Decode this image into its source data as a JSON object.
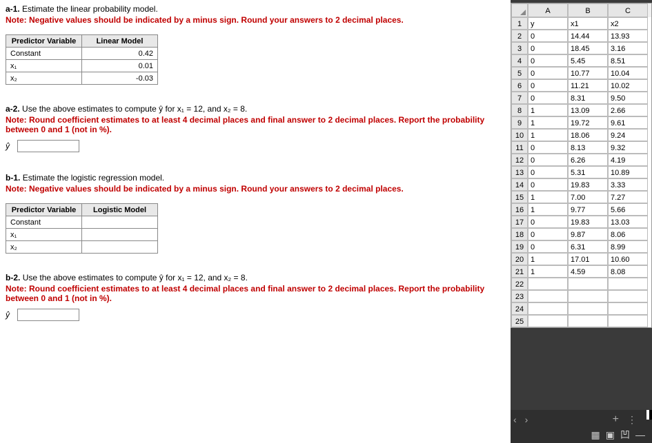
{
  "a1": {
    "title_prefix": "a-1.",
    "title_text": "Estimate the linear probability model.",
    "note": "Note: Negative values should be indicated by a minus sign. Round your answers to 2 decimal places.",
    "table": {
      "h1": "Predictor Variable",
      "h2": "Linear Model",
      "rows": [
        {
          "label": "Constant",
          "val": "0.42"
        },
        {
          "label": "x₁",
          "val": "0.01"
        },
        {
          "label": "x₂",
          "val": "-0.03"
        }
      ]
    }
  },
  "a2": {
    "title_prefix": "a-2.",
    "title_text": "Use the above estimates to compute ŷ for x₁ = 12, and x₂ = 8.",
    "note": "Note: Round coefficient estimates to at least 4 decimal places and final answer to 2 decimal places. Report the probability between 0 and 1 (not in %).",
    "yhat": "ŷ"
  },
  "b1": {
    "title_prefix": "b-1.",
    "title_text": "Estimate the logistic regression model.",
    "note": "Note: Negative values should be indicated by a minus sign. Round your answers to 2 decimal places.",
    "table": {
      "h1": "Predictor Variable",
      "h2": "Logistic Model",
      "rows": [
        {
          "label": "Constant",
          "val": ""
        },
        {
          "label": "x₁",
          "val": ""
        },
        {
          "label": "x₂",
          "val": ""
        }
      ]
    }
  },
  "b2": {
    "title_prefix": "b-2.",
    "title_text": "Use the above estimates to compute ŷ for x₁ = 12, and x₂ = 8.",
    "note": "Note: Round coefficient estimates to at least 4 decimal places and final answer to 2 decimal places. Report the probability between 0 and 1 (not in %).",
    "yhat": "ŷ"
  },
  "spreadsheet": {
    "cols": [
      "A",
      "B",
      "C"
    ],
    "rows": [
      {
        "n": "1",
        "a": "y",
        "b": "x1",
        "c": "x2"
      },
      {
        "n": "2",
        "a": "0",
        "b": "14.44",
        "c": "13.93"
      },
      {
        "n": "3",
        "a": "0",
        "b": "18.45",
        "c": "3.16"
      },
      {
        "n": "4",
        "a": "0",
        "b": "5.45",
        "c": "8.51"
      },
      {
        "n": "5",
        "a": "0",
        "b": "10.77",
        "c": "10.04"
      },
      {
        "n": "6",
        "a": "0",
        "b": "11.21",
        "c": "10.02"
      },
      {
        "n": "7",
        "a": "0",
        "b": "8.31",
        "c": "9.50"
      },
      {
        "n": "8",
        "a": "1",
        "b": "13.09",
        "c": "2.66"
      },
      {
        "n": "9",
        "a": "1",
        "b": "19.72",
        "c": "9.61"
      },
      {
        "n": "10",
        "a": "1",
        "b": "18.06",
        "c": "9.24"
      },
      {
        "n": "11",
        "a": "0",
        "b": "8.13",
        "c": "9.32"
      },
      {
        "n": "12",
        "a": "0",
        "b": "6.26",
        "c": "4.19"
      },
      {
        "n": "13",
        "a": "0",
        "b": "5.31",
        "c": "10.89"
      },
      {
        "n": "14",
        "a": "0",
        "b": "19.83",
        "c": "3.33"
      },
      {
        "n": "15",
        "a": "1",
        "b": "7.00",
        "c": "7.27"
      },
      {
        "n": "16",
        "a": "1",
        "b": "9.77",
        "c": "5.66"
      },
      {
        "n": "17",
        "a": "0",
        "b": "19.83",
        "c": "13.03"
      },
      {
        "n": "18",
        "a": "0",
        "b": "9.87",
        "c": "8.06"
      },
      {
        "n": "19",
        "a": "0",
        "b": "6.31",
        "c": "8.99"
      },
      {
        "n": "20",
        "a": "1",
        "b": "17.01",
        "c": "10.60"
      },
      {
        "n": "21",
        "a": "1",
        "b": "4.59",
        "c": "8.08"
      },
      {
        "n": "22",
        "a": "",
        "b": "",
        "c": ""
      },
      {
        "n": "23",
        "a": "",
        "b": "",
        "c": ""
      },
      {
        "n": "24",
        "a": "",
        "b": "",
        "c": ""
      },
      {
        "n": "25",
        "a": "",
        "b": "",
        "c": ""
      }
    ],
    "nav_prev": "‹",
    "nav_next": "›",
    "plus": "+",
    "dots": "⋮",
    "dash": "—",
    "grid_icon": "▦",
    "page_icon": "▣",
    "save_icon": "凹"
  }
}
